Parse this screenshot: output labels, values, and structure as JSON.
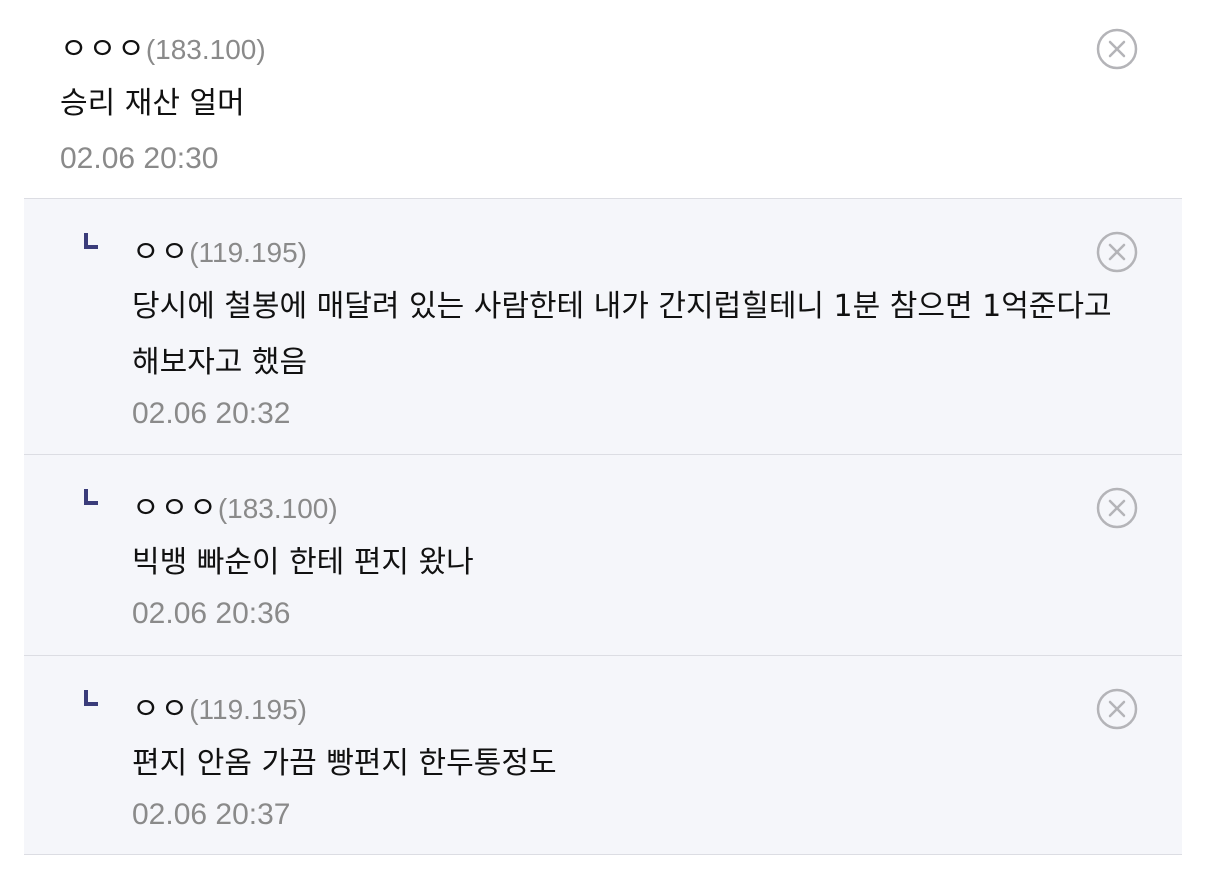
{
  "comments": [
    {
      "nick": "ㅇㅇㅇ",
      "ip": "(183.100)",
      "text": "승리 재산 얼머",
      "time": "02.06 20:30",
      "is_reply": false
    },
    {
      "nick": "ㅇㅇ",
      "ip": "(119.195)",
      "text": "당시에 철봉에 매달려 있는 사람한테 내가 간지럽힐테니 1분 참으면 1억준다고 해보자고 했음",
      "time": "02.06 20:32",
      "is_reply": true
    },
    {
      "nick": "ㅇㅇㅇ",
      "ip": "(183.100)",
      "text": "빅뱅 빠순이 한테 편지 왔나",
      "time": "02.06 20:36",
      "is_reply": true
    },
    {
      "nick": "ㅇㅇ",
      "ip": "(119.195)",
      "text": "편지 안옴 가끔 빵편지 한두통정도",
      "time": "02.06 20:37",
      "is_reply": true
    }
  ],
  "icons": {
    "delete": "close-circle-icon",
    "reply": "reply-indicator-icon"
  },
  "colors": {
    "reply_mark": "#3a3c7a",
    "meta_gray": "#8a8a8a",
    "reply_bg": "#f5f6fa"
  }
}
